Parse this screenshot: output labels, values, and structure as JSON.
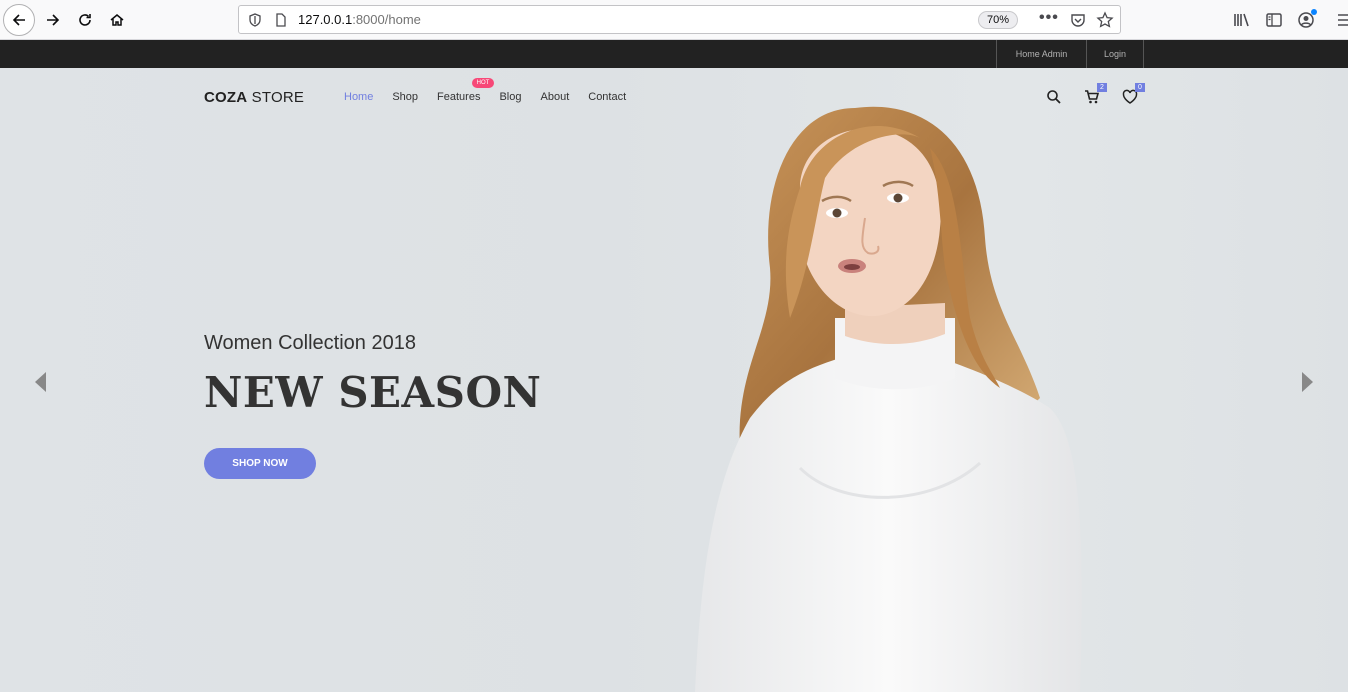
{
  "browser": {
    "url_host": "127.0.0.1",
    "url_path": ":8000/home",
    "zoom": "70%",
    "icons": [
      "back-icon",
      "forward-icon",
      "reload-icon",
      "home-icon",
      "shield-icon",
      "page-icon",
      "more-icon",
      "pocket-icon",
      "star-icon",
      "library-icon",
      "sidebar-icon",
      "account-icon",
      "menu-icon"
    ]
  },
  "topbar": {
    "admin_label": "Home Admin",
    "login_label": "Login"
  },
  "header": {
    "logo_bold": "COZA",
    "logo_rest": " STORE",
    "menu": [
      {
        "label": "Home",
        "active": true
      },
      {
        "label": "Shop"
      },
      {
        "label": "Features"
      },
      {
        "label": "Blog"
      },
      {
        "label": "About"
      },
      {
        "label": "Contact"
      }
    ],
    "hot_badge": "HOT",
    "cart_count": "2",
    "wishlist_count": "0"
  },
  "hero": {
    "subtitle": "Women Collection 2018",
    "title": "NEW SEASON",
    "button": "SHOP NOW"
  },
  "colors": {
    "accent": "#717fe0",
    "hot": "#f74877",
    "topbar": "#222222"
  }
}
